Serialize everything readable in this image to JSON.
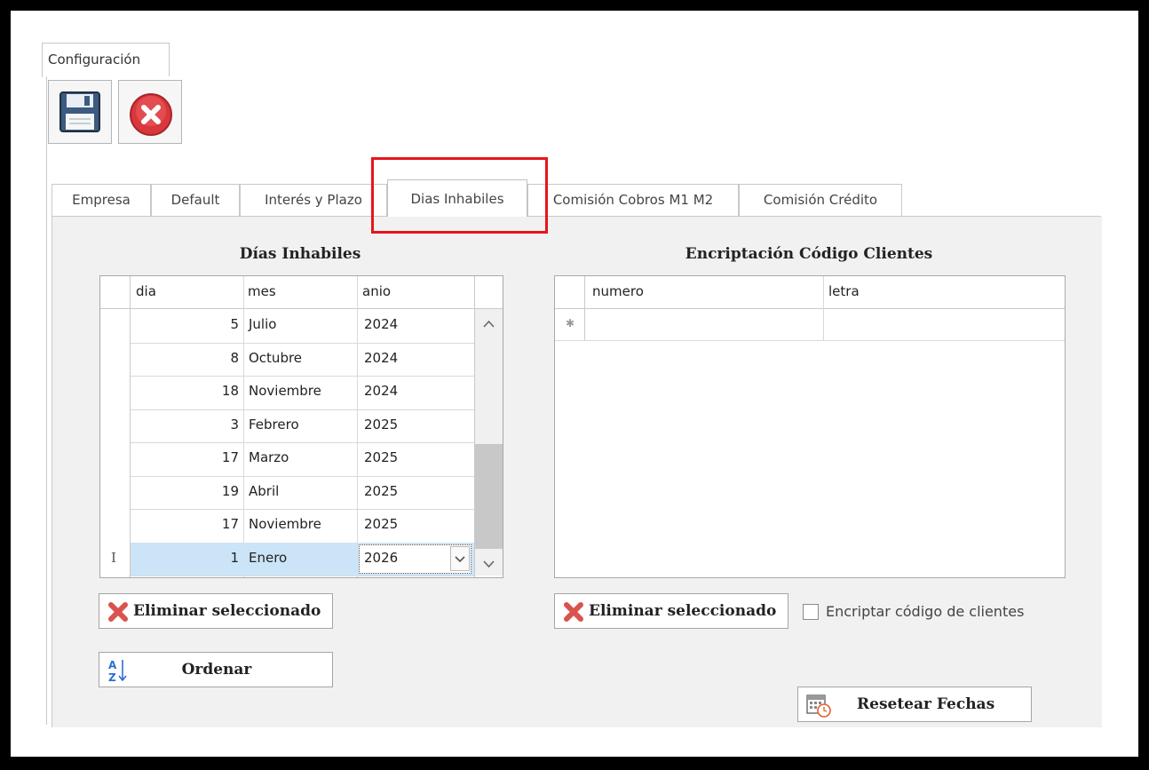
{
  "main_tab": {
    "label": "Configuración"
  },
  "toolbar": {
    "save_icon": "floppy-disk-icon",
    "cancel_icon": "red-x-circle-icon"
  },
  "tabs": [
    {
      "label": "Empresa"
    },
    {
      "label": "Default"
    },
    {
      "label": "Interés y Plazo"
    },
    {
      "label": "Dias Inhabiles",
      "active": true
    },
    {
      "label": "Comisión Cobros M1 M2"
    },
    {
      "label": "Comisión Crédito"
    }
  ],
  "dias_section": {
    "title": "Días Inhabiles",
    "columns": [
      "dia",
      "mes",
      "anio"
    ],
    "rows": [
      {
        "dia": "5",
        "mes": "Julio",
        "anio": "2024"
      },
      {
        "dia": "8",
        "mes": "Octubre",
        "anio": "2024"
      },
      {
        "dia": "18",
        "mes": "Noviembre",
        "anio": "2024"
      },
      {
        "dia": "3",
        "mes": "Febrero",
        "anio": "2025"
      },
      {
        "dia": "17",
        "mes": "Marzo",
        "anio": "2025"
      },
      {
        "dia": "19",
        "mes": "Abril",
        "anio": "2025"
      },
      {
        "dia": "17",
        "mes": "Noviembre",
        "anio": "2025"
      },
      {
        "dia": "1",
        "mes": "Enero",
        "anio": "2026",
        "selected": true
      }
    ],
    "edit_indicator": "I",
    "delete_button": "Eliminar seleccionado",
    "sort_button": "Ordenar"
  },
  "enc_section": {
    "title": "Encriptación Código Clientes",
    "columns": [
      "numero",
      "letra"
    ],
    "new_row_marker": "✱",
    "delete_button": "Eliminar seleccionado",
    "checkbox_label": "Encriptar código de clientes",
    "checkbox_checked": false,
    "reset_button": "Resetear Fechas"
  },
  "colors": {
    "highlight": "#e8141b",
    "selected_row": "#cce4f7",
    "delete_icon": "#d9534f"
  }
}
